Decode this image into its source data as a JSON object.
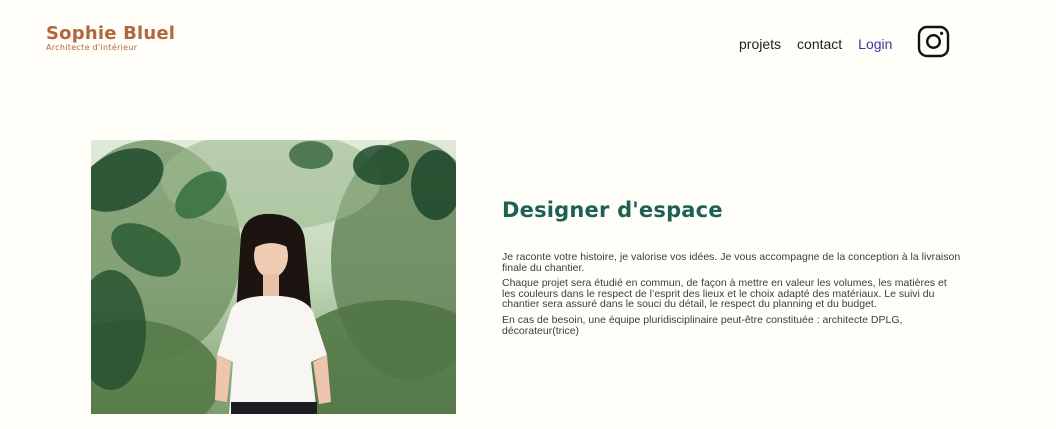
{
  "brand": {
    "name": "Sophie Bluel",
    "subtitle": "Architecte d'intérieur"
  },
  "nav": {
    "items": [
      {
        "label": "projets"
      },
      {
        "label": "contact"
      },
      {
        "label": "Login"
      }
    ],
    "instagram_icon": "instagram-icon"
  },
  "introduction": {
    "title": "Designer d'espace",
    "paragraphs": [
      "Je raconte votre histoire, je valorise vos idées. Je vous accompagne de la conception à la livraison finale du chantier.",
      "Chaque projet sera étudié en commun, de façon à mettre en valeur les volumes, les matières et les couleurs dans le respect de l’esprit des lieux et le choix adapté des matériaux. Le suivi du chantier sera assuré dans le souci du détail, le respect du planning et du budget.",
      "En cas de besoin, une équipe pluridisciplinaire peut-être constituée : architecte DPLG, décorateur(trice)"
    ]
  },
  "colors": {
    "background": "#fffef8",
    "brand": "#b1663c",
    "title": "#1d6154",
    "login": "#3d3a9e"
  }
}
